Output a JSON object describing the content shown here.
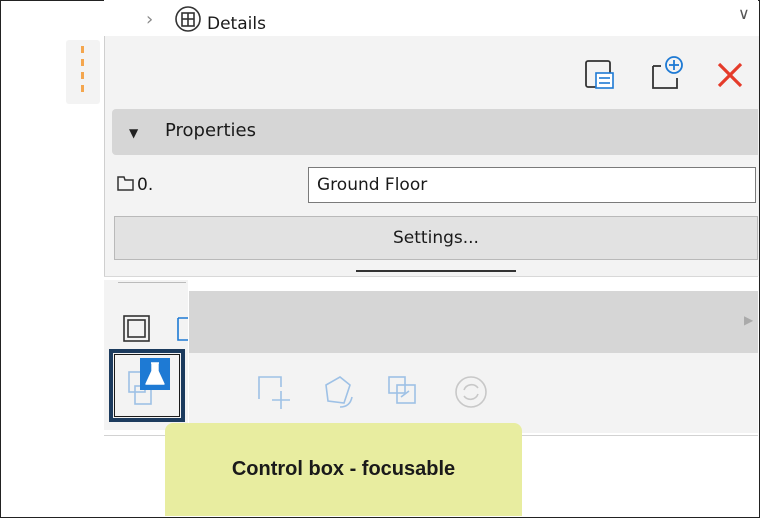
{
  "tree": {
    "details_label": "Details"
  },
  "properties": {
    "header_label": "Properties",
    "floor_number": "0.",
    "floor_name": "Ground Floor",
    "settings_label": "Settings..."
  },
  "tooltip": {
    "text": "Control box - focusable"
  },
  "colors": {
    "accent": "#1e7ad4",
    "close": "#e53b2a",
    "focus_border": "#1c3b5e",
    "tooltip_bg": "#e8eda0",
    "dash": "#f4a64e"
  },
  "icons": [
    "chevron-right-icon",
    "layer-circle-icon",
    "chevron-down-icon",
    "window-list-icon",
    "new-window-icon",
    "close-icon",
    "triangle-down-icon",
    "folder-icon",
    "frame-icon",
    "copy-icon",
    "flask-icon",
    "move-icon",
    "rotate-icon",
    "mirror-icon",
    "refresh-icon"
  ]
}
